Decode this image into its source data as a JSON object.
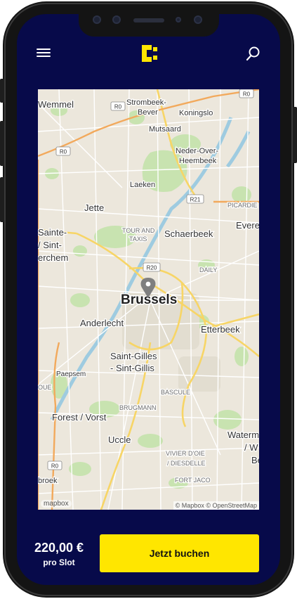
{
  "app": {
    "logo_icon": "c-logo-icon",
    "accent_color": "#ffe600",
    "background_color": "#070a4a"
  },
  "header": {
    "menu_icon": "hamburger-menu-icon",
    "search_icon": "search-icon"
  },
  "map": {
    "city": "Brussels",
    "marker_icon": "map-pin-icon",
    "labels": {
      "wemmel": "Wemmel",
      "strombeek": "Strombeek-",
      "bever": "Bever",
      "koningslo": "Koningslo",
      "mutsaard": "Mutsaard",
      "neder": "Neder-Over-",
      "heembeek": "Heembeek",
      "laeken": "Laeken",
      "jette": "Jette",
      "picardie": "PICARDIE",
      "evere": "Evere",
      "sainte": "Sainte-",
      "sint": "/ Sint-",
      "erchem": "erchem",
      "tour1": "TOUR AND",
      "tour2": "TAXIS",
      "schaerbeek": "Schaerbeek",
      "daily": "DAILY",
      "anderlecht": "Anderlecht",
      "etterbeek": "Etterbeek",
      "saintgilles": "Saint-Gilles",
      "sintgillis": "- Sint-Gillis",
      "paepsem": "Paepsem",
      "oue": "OUE",
      "bascule": "BASCULE",
      "brugmann": "BRUGMANN",
      "forest": "Forest / Vorst",
      "uccle": "Uccle",
      "waterm": "Waterm",
      "wslash": "/ W",
      "be": "Be",
      "vivier": "VIVIER D'OIE",
      "diesdelle": "/ DIESDELLE",
      "fortjaco": "FORT JACO",
      "broek": "broek",
      "r0": "R0",
      "r20": "R20",
      "r21": "R21"
    },
    "attribution_logo": "mapbox",
    "attribution_text": "© Mapbox © OpenStreetMap"
  },
  "footer": {
    "price": "220,00 €",
    "price_unit": "pro Slot",
    "book_button": "Jetzt buchen"
  }
}
